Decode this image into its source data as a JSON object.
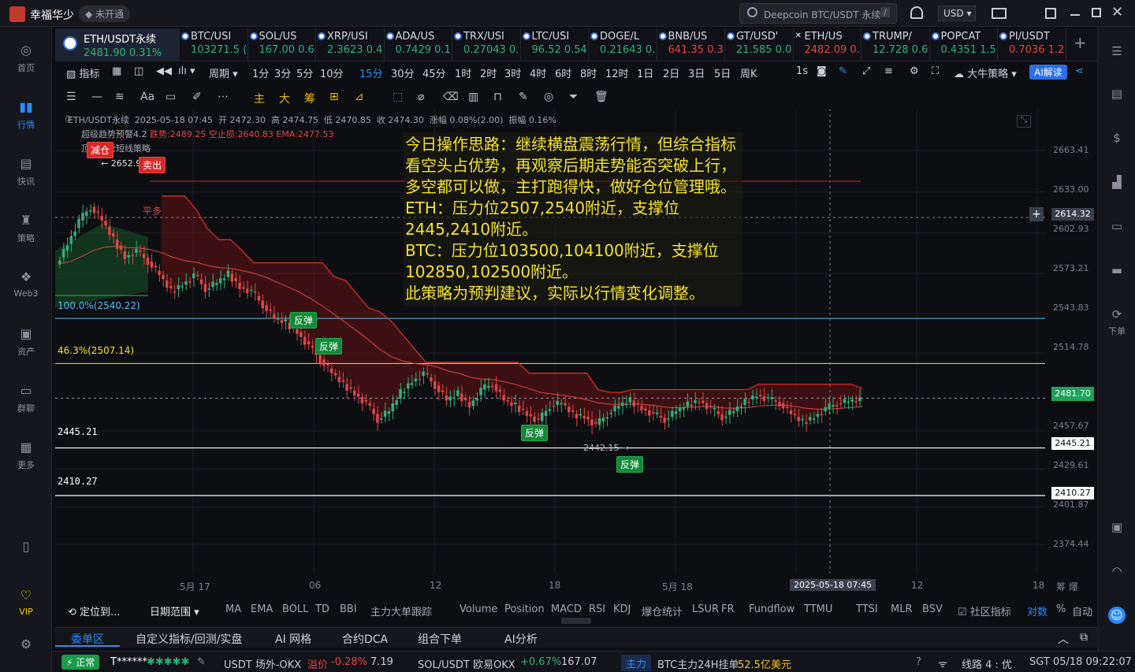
{
  "app": {
    "title": "幸福华少",
    "status_tag": "未开通",
    "search_placeholder": "Deepcoin BTC/USDT 永续",
    "currency": "USD",
    "search_shortcut": "/"
  },
  "sidebar": [
    {
      "label": "首页",
      "icon": "home-icon"
    },
    {
      "label": "行情",
      "icon": "market-chart-icon",
      "active": true
    },
    {
      "label": "快讯",
      "icon": "news-icon"
    },
    {
      "label": "策略",
      "icon": "strategy-icon"
    },
    {
      "label": "Web3",
      "icon": "web3-icon"
    },
    {
      "label": "资产",
      "icon": "wallet-icon"
    },
    {
      "label": "群聊",
      "icon": "chat-icon"
    },
    {
      "label": "更多",
      "icon": "grid-icon"
    },
    {
      "label": "",
      "icon": "phone-icon"
    },
    {
      "label": "VIP",
      "icon": "vip-icon"
    },
    {
      "label": "",
      "icon": "settings-icon"
    }
  ],
  "tabs": [
    {
      "name": "ETH/USDT永续",
      "price": "2481.90 0.31%",
      "up": true,
      "active": true
    },
    {
      "name": "BTC/USI",
      "price": "103271.5 (",
      "up": true
    },
    {
      "name": "SOL/US",
      "price": "167.00 0.6",
      "up": true
    },
    {
      "name": "XRP/USI",
      "price": "2.3623 0.4",
      "up": true
    },
    {
      "name": "ADA/US",
      "price": "0.7429 0.1",
      "up": true
    },
    {
      "name": "TRX/USI",
      "price": "0.27043 0.",
      "up": true
    },
    {
      "name": "LTC/USI",
      "price": "96.52 0.54",
      "up": true
    },
    {
      "name": "DOGE/L",
      "price": "0.21643 0.",
      "up": true
    },
    {
      "name": "BNB/US",
      "price": "641.35 0.3",
      "up": false
    },
    {
      "name": "GT/USD'",
      "price": "21.585 0.0",
      "up": true
    },
    {
      "name": "ETH/US",
      "price": "2482.09 0.",
      "up": false
    },
    {
      "name": "TRUMP/",
      "price": "12.728 0.6",
      "up": true
    },
    {
      "name": "POPCAT",
      "price": "0.4351 1.5",
      "up": true
    },
    {
      "name": "PI/USDT",
      "price": "0.7036 1.2",
      "up": false
    }
  ],
  "toolbar": {
    "indicator": "指标",
    "period": "周期",
    "intervals": [
      "1分",
      "3分",
      "5分",
      "10分",
      "15分",
      "30分",
      "45分",
      "1时",
      "2时",
      "3时",
      "4时",
      "6时",
      "8时",
      "12时",
      "1日",
      "2日",
      "3日",
      "5日",
      "周K"
    ],
    "selected_interval": "15分",
    "speed": "1s",
    "strategy": "大牛策略",
    "ai": "AI解读"
  },
  "draw_tools": [
    "主",
    "大",
    "筹"
  ],
  "chart": {
    "header_line": "ETH/USDT永续  2025-05-18 07:45  开 2472.30  高 2474.75  低 2470.85  收 2474.30  涨幅 0.08%(2.00)  振幅 0.16%",
    "indicator_line1": "超级趋势预警4.2",
    "indicator_line1_values": "跌势:2489.25  空止损:2640.83  EMA:2477.53",
    "indicator_line2": "顶部减仓短线策略",
    "high_marker": "2652.9",
    "sell_badge": "卖出",
    "reduce_badge": "减仓",
    "flat_label": "平多",
    "fib_100": "100.0%(2540.22)",
    "fib_46": "46.3%(2507.14)",
    "support_1": "2445.21",
    "support_2": "2410.27",
    "low_marker": "2442.15",
    "rebound": "反弹",
    "note_lines": [
      "今日操作思路：继续横盘震荡行情，但综合指标看空头占优势，再观察后期走势能否突破上行，多空都可以做，主打跑得快，做好仓位管理哦。",
      "ETH：压力位2507,2540附近，支撑位2445,2410附近。",
      "BTC：压力位103500,104100附近，支撑位102850,102500附近。",
      "此策略为预判建议，实际以行情变化调整。"
    ],
    "price_ticks": [
      "2663.41",
      "2633.00",
      "2602.93",
      "2573.21",
      "2543.83",
      "2514.78",
      "2457.67",
      "2429.61",
      "2401.87",
      "2374.44"
    ],
    "crosshair_price": "2614.32",
    "last_price": "2481.70",
    "date_ticks": [
      "5月 17",
      "06",
      "12",
      "18",
      "5月 18",
      "12",
      "18"
    ],
    "crosshair_time": "2025-05-18 07:45",
    "colors": {
      "up": "#2fb07c",
      "down": "#e04545",
      "accent": "#2a8cff",
      "note": "#f5e326"
    }
  },
  "indicators_bar": {
    "left": [
      "定位到...",
      "日期范围"
    ],
    "items": [
      "MA",
      "EMA",
      "BOLL",
      "TD",
      "BBI",
      "主力大单跟踪",
      "Volume",
      "Position",
      "MACD",
      "RSI",
      "KDJ",
      "爆仓统计",
      "LSUR",
      "FR",
      "Fundflow",
      "TTMU",
      "TTSI",
      "MLR",
      "BSV"
    ],
    "community": "社区指标",
    "log": "对数",
    "pct": "%",
    "auto": "自动"
  },
  "bottom_tabs": [
    "委单区",
    "自定义指标/回测/实盘",
    "AI 网格",
    "合约DCA",
    "组合下单",
    "AI分析"
  ],
  "status": {
    "state": "正常",
    "user": "T******",
    "pair1": "USDT 场外-OKX",
    "pair1_label": "溢价",
    "pair1_change": "-0.28%",
    "pair1_value": "7.19",
    "pair2": "SOL/USDT 欧易OKX",
    "pair2_change": "+0.67%",
    "pair2_value": "167.07",
    "main_tag": "主力",
    "main_text": "BTC主力24H挂单",
    "main_value": "52.5亿美元",
    "line": "线路 4 : 优",
    "time": "SGT  05/18 09:22:07"
  }
}
